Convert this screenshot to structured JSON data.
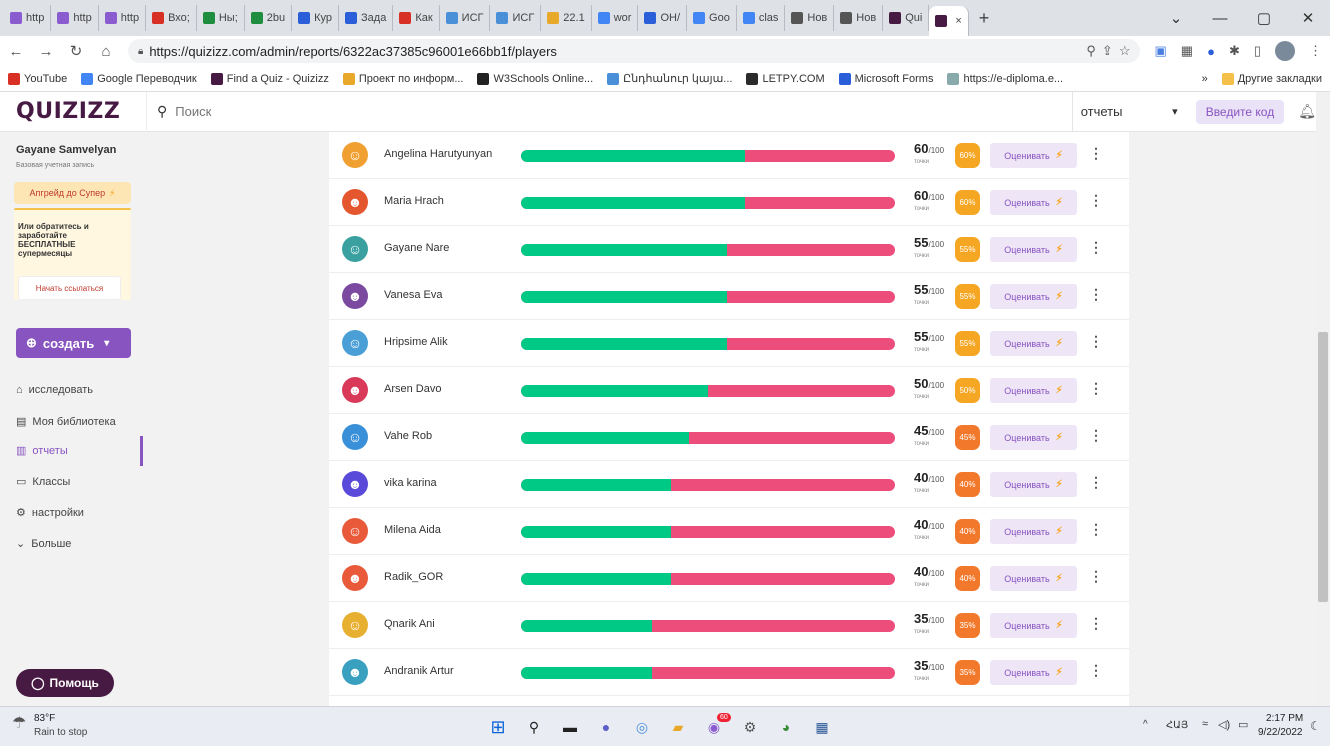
{
  "browser": {
    "tabs": [
      "http",
      "http",
      "http",
      "Вхо;",
      "Ны;",
      "2bu",
      "Кур",
      "Зада",
      "Как",
      "ИСГ",
      "ИСГ",
      "22.1",
      "wor",
      "ОН/",
      "Goo",
      "clas",
      "Нов",
      "Нов",
      "Qui",
      ""
    ],
    "new_tab": "+",
    "url": "https://quizizz.com/admin/reports/6322ac37385c96001e66bb1f/players",
    "bookmarks": [
      "YouTube",
      "Google Переводчик",
      "Find a Quiz - Quizizz",
      "Проект по информ...",
      "W3Schools Online...",
      "Ընդհանուր կայա...",
      "LETPY.COM",
      "Microsoft Forms",
      "https://e-diploma.e..."
    ],
    "bookmarks_more": "»",
    "other_bookmarks": "Другие закладки"
  },
  "header": {
    "logo": "QUIZIZZ",
    "search_placeholder": "Поиск",
    "report_select": "отчеты",
    "code_button": "Введите код"
  },
  "sidebar": {
    "user_name": "Gayane Samvelyan",
    "account_type": "Базовая учетная запись",
    "upgrade": "Апгрейд до Супер",
    "promo": "Или обратитесь и заработайте БЕСПЛАТНЫЕ супермесяцы",
    "refer": "Начать ссылаться",
    "create": "создать",
    "nav": [
      "исследовать",
      "Моя библиотека",
      "отчеты",
      "Классы",
      "настройки",
      "Больше"
    ],
    "help": "Помощь"
  },
  "players": [
    {
      "name": "Angelina Harutyunyan",
      "score": 60,
      "total": "/100",
      "pct": "60%",
      "color": "#f5a623",
      "avatar": "#f0a030"
    },
    {
      "name": "Maria Hrach",
      "score": 60,
      "total": "/100",
      "pct": "60%",
      "color": "#f5a623",
      "avatar": "#e4572e"
    },
    {
      "name": "Gayane Nare",
      "score": 55,
      "total": "/100",
      "pct": "55%",
      "color": "#f5a623",
      "avatar": "#3aa0a0"
    },
    {
      "name": "Vanesa Eva",
      "score": 55,
      "total": "/100",
      "pct": "55%",
      "color": "#f5a623",
      "avatar": "#7b4aa0"
    },
    {
      "name": "Hripsime Alik",
      "score": 55,
      "total": "/100",
      "pct": "55%",
      "color": "#f5a623",
      "avatar": "#4a9fd6"
    },
    {
      "name": "Arsen Davo",
      "score": 50,
      "total": "/100",
      "pct": "50%",
      "color": "#f5a623",
      "avatar": "#d93a5a"
    },
    {
      "name": "Vahe Rob",
      "score": 45,
      "total": "/100",
      "pct": "45%",
      "color": "#f2792b",
      "avatar": "#3a8fd9"
    },
    {
      "name": "vika karina",
      "score": 40,
      "total": "/100",
      "pct": "40%",
      "color": "#f2792b",
      "avatar": "#5a4ad9"
    },
    {
      "name": "Milena Aida",
      "score": 40,
      "total": "/100",
      "pct": "40%",
      "color": "#f2792b",
      "avatar": "#e85a3a"
    },
    {
      "name": "Radik_GOR",
      "score": 40,
      "total": "/100",
      "pct": "40%",
      "color": "#f2792b",
      "avatar": "#e85a3a"
    },
    {
      "name": "Qnarik Ani",
      "score": 35,
      "total": "/100",
      "pct": "35%",
      "color": "#f2792b",
      "avatar": "#e8b030"
    },
    {
      "name": "Andranik Artur",
      "score": 35,
      "total": "/100",
      "pct": "35%",
      "color": "#f2792b",
      "avatar": "#3aa0c0"
    }
  ],
  "row_labels": {
    "points": "точки",
    "grade": "Оценивать"
  },
  "taskbar": {
    "weather_temp": "83°F",
    "weather_desc": "Rain to stop",
    "lang": "ՀԱՅ",
    "time": "2:17 PM",
    "date": "9/22/2022",
    "badge": "60"
  }
}
